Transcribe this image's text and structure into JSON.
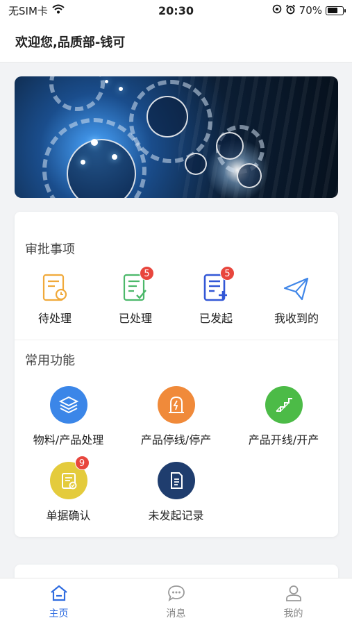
{
  "status_bar": {
    "carrier": "无SIM卡",
    "time": "20:30",
    "battery_percent": "70%",
    "battery_level": 0.7
  },
  "header": {
    "title": "欢迎您,品质部-钱可"
  },
  "approval": {
    "title": "审批事项",
    "items": [
      {
        "label": "待处理",
        "icon": "pending-document-clock-icon",
        "badge": ""
      },
      {
        "label": "已处理",
        "icon": "processed-document-check-icon",
        "badge": "5"
      },
      {
        "label": "已发起",
        "icon": "initiated-document-plus-icon",
        "badge": "5"
      },
      {
        "label": "我收到的",
        "icon": "paper-plane-icon",
        "badge": ""
      }
    ]
  },
  "functions": {
    "title": "常用功能",
    "items": [
      {
        "label": "物料/产品处理",
        "icon": "layers-icon",
        "color": "#3b86e8",
        "badge": ""
      },
      {
        "label": "产品停线/停产",
        "icon": "tombstone-lightning-icon",
        "color": "#f08a3a",
        "badge": ""
      },
      {
        "label": "产品开线/开产",
        "icon": "stairs-icon",
        "color": "#4cbb47",
        "badge": ""
      },
      {
        "label": "单据确认",
        "icon": "document-check-icon",
        "color": "#e4cb3c",
        "badge": "9"
      },
      {
        "label": "未发起记录",
        "icon": "document-lines-icon",
        "color": "#1f3d6e",
        "badge": ""
      }
    ]
  },
  "tabbar": {
    "tabs": [
      {
        "label": "主页",
        "icon": "home-icon",
        "active": true
      },
      {
        "label": "消息",
        "icon": "chat-bubble-icon",
        "active": false
      },
      {
        "label": "我的",
        "icon": "user-icon",
        "active": false
      }
    ],
    "active_color": "#2f6ce0"
  }
}
